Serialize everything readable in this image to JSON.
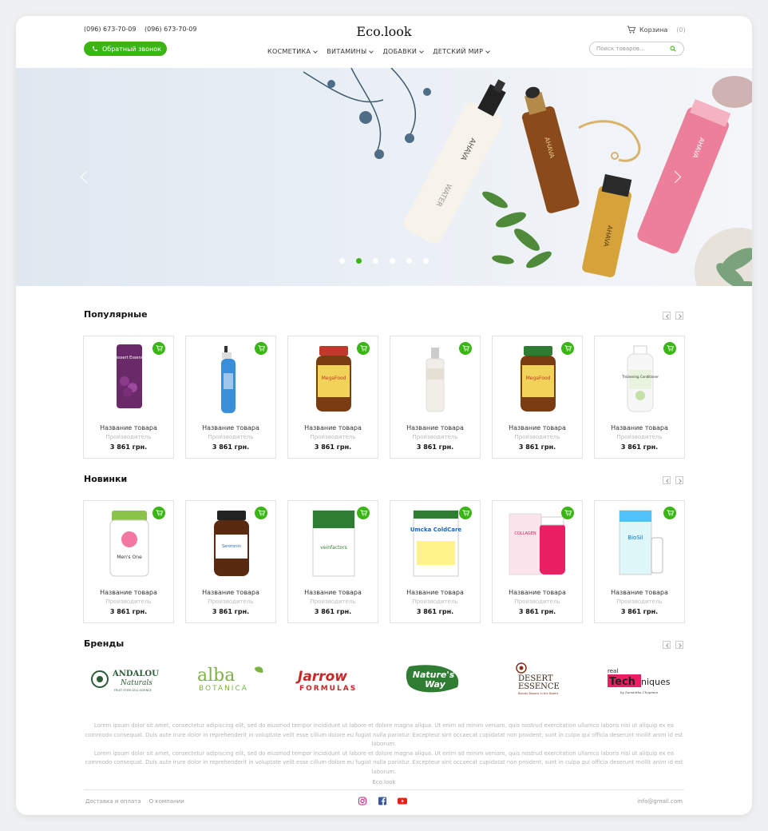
{
  "header": {
    "phones": [
      "(096) 673-70-09",
      "(096) 673-70-09"
    ],
    "callback_label": "Обратный звонок",
    "logo": "Eco.look",
    "nav": [
      "КОСМЕТИКА",
      "ВИТАМИНЫ",
      "ДОБАВКИ",
      "ДЕТСКИЙ МИР"
    ],
    "cart_label": "Корзина",
    "cart_count": "(0)",
    "search_placeholder": "Поиск товаров..."
  },
  "hero": {
    "slides_count": 6,
    "active_slide": 2,
    "product_texts": [
      "AHAVA",
      "WATER",
      "AHAVA",
      "AHAVA",
      "AHAVA"
    ]
  },
  "sections": {
    "popular": {
      "title": "Популярные",
      "products": [
        {
          "name": "Название товара",
          "maker": "Производитель",
          "price": "3 861 грн."
        },
        {
          "name": "Название товара",
          "maker": "Производитель",
          "price": "3 861 грн."
        },
        {
          "name": "Название товара",
          "maker": "Производитель",
          "price": "3 861 грн."
        },
        {
          "name": "Название товара",
          "maker": "Производитель",
          "price": "3 861 грн."
        },
        {
          "name": "Название товара",
          "maker": "Производитель",
          "price": "3 861 грн."
        },
        {
          "name": "Название товара",
          "maker": "Производитель",
          "price": "3 861 грн."
        }
      ]
    },
    "new": {
      "title": "Новинки",
      "products": [
        {
          "name": "Название товара",
          "maker": "Производитель",
          "price": "3 861 грн."
        },
        {
          "name": "Название товара",
          "maker": "Производитель",
          "price": "3 861 грн."
        },
        {
          "name": "Название товара",
          "maker": "Производитель",
          "price": "3 861 грн."
        },
        {
          "name": "Название товара",
          "maker": "Производитель",
          "price": "3 861 грн."
        },
        {
          "name": "Название товара",
          "maker": "Производитель",
          "price": "3 861 грн."
        },
        {
          "name": "Название товара",
          "maker": "Производитель",
          "price": "3 861 грн."
        }
      ]
    },
    "brands": {
      "title": "Бренды",
      "items": [
        {
          "line1": "ANDALOU",
          "line2": "Naturals",
          "line3": "FRUIT STEM CELL SCIENCE"
        },
        {
          "line1": "alba",
          "line2": "BOTANICA"
        },
        {
          "line1": "Jarrow",
          "line2": "FORMULAS"
        },
        {
          "line1": "Nature's",
          "line2": "Way"
        },
        {
          "line1": "DESERT",
          "line2": "ESSENCE",
          "line3": "Beauty Blooms in the Desert"
        },
        {
          "line1": "real",
          "line2": "Tech",
          "line3": "niques",
          "line4": "by Samantha Chapman"
        }
      ]
    }
  },
  "product_labels": [
    "Dessert Essence",
    "",
    "MegaFood",
    "",
    "MegaFood",
    "Thickening Conditioner",
    "Men's One",
    "Serotonin",
    "veinfactors",
    "Umcka ColdCare",
    "COLLAGEN",
    "BioSil"
  ],
  "footer": {
    "lorem": [
      "Lorem ipsum dolor sit amet, consectetur adipiscing elit, sed do eiusmod tempor incididunt ut labore et dolore magna aliqua. Ut enim ad minim veniam, quis nostrud exercitation ullamco laboris nisi ut aliquip ex ea commodo consequat. Duis aute irure dolor in reprehenderit in voluptate velit esse cillum dolore eu fugiat nulla pariatur. Excepteur sint occaecat cupidatat non proident, sunt in culpa qui officia deserunt mollit anim id est laborum.",
      "Lorem ipsum dolor sit amet, consectetur adipiscing elit, sed do eiusmod tempor incididunt ut labore et dolore magna aliqua. Ut enim ad minim veniam, quis nostrud exercitation ullamco laboris nisi ut aliquip ex ea commodo consequat. Duis aute irure dolor in reprehenderit in voluptate velit esse cillum dolore eu fugiat nulla pariatur. Excepteur sint occaecat cupidatat non proident, sunt in culpa qui officia deserunt mollit anim id est laborum."
    ],
    "brand": "Eco.look",
    "links": [
      "Доставка и оплата",
      "О компании"
    ],
    "email": "info@gmail.com",
    "social_icons": [
      "instagram-icon",
      "facebook-icon",
      "youtube-icon"
    ]
  },
  "colors": {
    "accent": "#3bb515",
    "instagram": "#c13584",
    "facebook": "#3b5998",
    "youtube": "#e62117"
  }
}
